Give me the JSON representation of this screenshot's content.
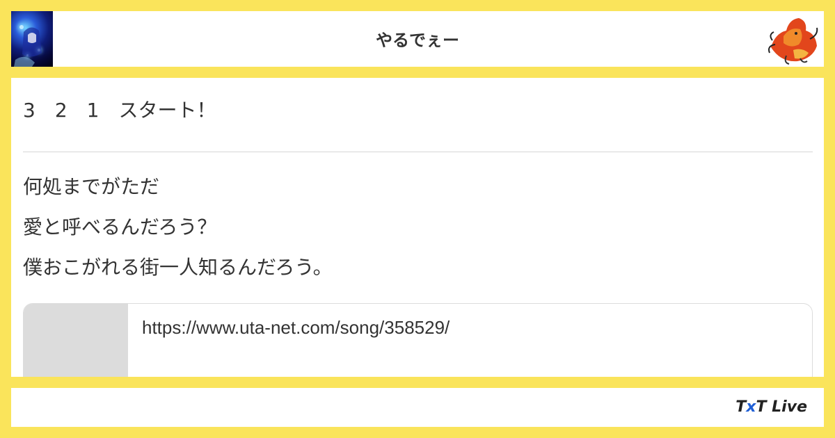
{
  "header": {
    "title": "やるでぇー",
    "left_avatar_icon": "user-avatar-blue-illustration",
    "right_avatar_icon": "red-creature-illustration"
  },
  "post": {
    "headline": "3　2　1　スタート！",
    "lyrics": [
      "何処までがただ",
      "愛と呼べるんだろう？",
      "僕おこがれる街一人知るんだろう。"
    ],
    "link_card": {
      "url": "https://www.uta-net.com/song/358529/"
    }
  },
  "footer": {
    "brand_prefix": "T",
    "brand_x": "x",
    "brand_suffix": "T Live"
  },
  "colors": {
    "background": "#fae45b",
    "panel": "#ffffff",
    "text": "#333333",
    "divider": "#d6d6d6",
    "thumb": "#dcdcdc",
    "brand_accent": "#1f5fd6"
  }
}
